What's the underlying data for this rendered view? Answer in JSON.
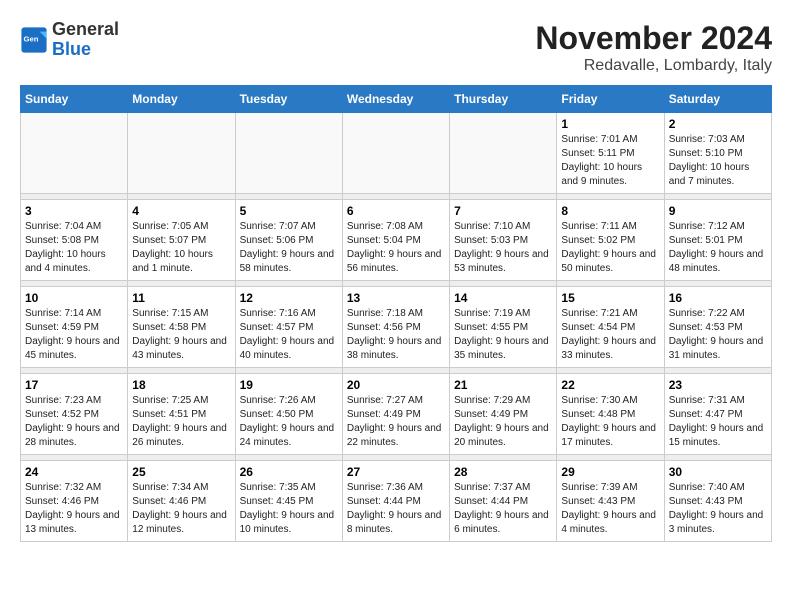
{
  "header": {
    "logo_general": "General",
    "logo_blue": "Blue",
    "month_title": "November 2024",
    "location": "Redavalle, Lombardy, Italy"
  },
  "calendar": {
    "days_of_week": [
      "Sunday",
      "Monday",
      "Tuesday",
      "Wednesday",
      "Thursday",
      "Friday",
      "Saturday"
    ],
    "weeks": [
      [
        {
          "day": "",
          "info": ""
        },
        {
          "day": "",
          "info": ""
        },
        {
          "day": "",
          "info": ""
        },
        {
          "day": "",
          "info": ""
        },
        {
          "day": "",
          "info": ""
        },
        {
          "day": "1",
          "info": "Sunrise: 7:01 AM\nSunset: 5:11 PM\nDaylight: 10 hours and 9 minutes."
        },
        {
          "day": "2",
          "info": "Sunrise: 7:03 AM\nSunset: 5:10 PM\nDaylight: 10 hours and 7 minutes."
        }
      ],
      [
        {
          "day": "3",
          "info": "Sunrise: 7:04 AM\nSunset: 5:08 PM\nDaylight: 10 hours and 4 minutes."
        },
        {
          "day": "4",
          "info": "Sunrise: 7:05 AM\nSunset: 5:07 PM\nDaylight: 10 hours and 1 minute."
        },
        {
          "day": "5",
          "info": "Sunrise: 7:07 AM\nSunset: 5:06 PM\nDaylight: 9 hours and 58 minutes."
        },
        {
          "day": "6",
          "info": "Sunrise: 7:08 AM\nSunset: 5:04 PM\nDaylight: 9 hours and 56 minutes."
        },
        {
          "day": "7",
          "info": "Sunrise: 7:10 AM\nSunset: 5:03 PM\nDaylight: 9 hours and 53 minutes."
        },
        {
          "day": "8",
          "info": "Sunrise: 7:11 AM\nSunset: 5:02 PM\nDaylight: 9 hours and 50 minutes."
        },
        {
          "day": "9",
          "info": "Sunrise: 7:12 AM\nSunset: 5:01 PM\nDaylight: 9 hours and 48 minutes."
        }
      ],
      [
        {
          "day": "10",
          "info": "Sunrise: 7:14 AM\nSunset: 4:59 PM\nDaylight: 9 hours and 45 minutes."
        },
        {
          "day": "11",
          "info": "Sunrise: 7:15 AM\nSunset: 4:58 PM\nDaylight: 9 hours and 43 minutes."
        },
        {
          "day": "12",
          "info": "Sunrise: 7:16 AM\nSunset: 4:57 PM\nDaylight: 9 hours and 40 minutes."
        },
        {
          "day": "13",
          "info": "Sunrise: 7:18 AM\nSunset: 4:56 PM\nDaylight: 9 hours and 38 minutes."
        },
        {
          "day": "14",
          "info": "Sunrise: 7:19 AM\nSunset: 4:55 PM\nDaylight: 9 hours and 35 minutes."
        },
        {
          "day": "15",
          "info": "Sunrise: 7:21 AM\nSunset: 4:54 PM\nDaylight: 9 hours and 33 minutes."
        },
        {
          "day": "16",
          "info": "Sunrise: 7:22 AM\nSunset: 4:53 PM\nDaylight: 9 hours and 31 minutes."
        }
      ],
      [
        {
          "day": "17",
          "info": "Sunrise: 7:23 AM\nSunset: 4:52 PM\nDaylight: 9 hours and 28 minutes."
        },
        {
          "day": "18",
          "info": "Sunrise: 7:25 AM\nSunset: 4:51 PM\nDaylight: 9 hours and 26 minutes."
        },
        {
          "day": "19",
          "info": "Sunrise: 7:26 AM\nSunset: 4:50 PM\nDaylight: 9 hours and 24 minutes."
        },
        {
          "day": "20",
          "info": "Sunrise: 7:27 AM\nSunset: 4:49 PM\nDaylight: 9 hours and 22 minutes."
        },
        {
          "day": "21",
          "info": "Sunrise: 7:29 AM\nSunset: 4:49 PM\nDaylight: 9 hours and 20 minutes."
        },
        {
          "day": "22",
          "info": "Sunrise: 7:30 AM\nSunset: 4:48 PM\nDaylight: 9 hours and 17 minutes."
        },
        {
          "day": "23",
          "info": "Sunrise: 7:31 AM\nSunset: 4:47 PM\nDaylight: 9 hours and 15 minutes."
        }
      ],
      [
        {
          "day": "24",
          "info": "Sunrise: 7:32 AM\nSunset: 4:46 PM\nDaylight: 9 hours and 13 minutes."
        },
        {
          "day": "25",
          "info": "Sunrise: 7:34 AM\nSunset: 4:46 PM\nDaylight: 9 hours and 12 minutes."
        },
        {
          "day": "26",
          "info": "Sunrise: 7:35 AM\nSunset: 4:45 PM\nDaylight: 9 hours and 10 minutes."
        },
        {
          "day": "27",
          "info": "Sunrise: 7:36 AM\nSunset: 4:44 PM\nDaylight: 9 hours and 8 minutes."
        },
        {
          "day": "28",
          "info": "Sunrise: 7:37 AM\nSunset: 4:44 PM\nDaylight: 9 hours and 6 minutes."
        },
        {
          "day": "29",
          "info": "Sunrise: 7:39 AM\nSunset: 4:43 PM\nDaylight: 9 hours and 4 minutes."
        },
        {
          "day": "30",
          "info": "Sunrise: 7:40 AM\nSunset: 4:43 PM\nDaylight: 9 hours and 3 minutes."
        }
      ]
    ]
  }
}
